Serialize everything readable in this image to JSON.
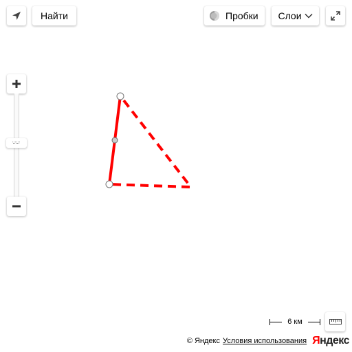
{
  "controls": {
    "geolocation_icon": "arrow-icon",
    "search_label": "Найти",
    "traffic_label": "Пробки",
    "traffic_icon": "traffic-light-icon",
    "layers_label": "Слои",
    "fullscreen_icon": "expand-icon",
    "zoom_in_icon": "plus-icon",
    "zoom_out_icon": "minus-icon",
    "ruler_icon": "ruler-icon"
  },
  "scale": {
    "label": "6 км"
  },
  "copyright": {
    "text": "© Яндекс",
    "terms_link": "Условия использования",
    "logo_first": "Я",
    "logo_rest": "ндекс"
  },
  "polygon": {
    "stroke_color": "#ff0000",
    "vertex_fill": "#ffffff",
    "midpoint_fill": "#cccccc"
  }
}
